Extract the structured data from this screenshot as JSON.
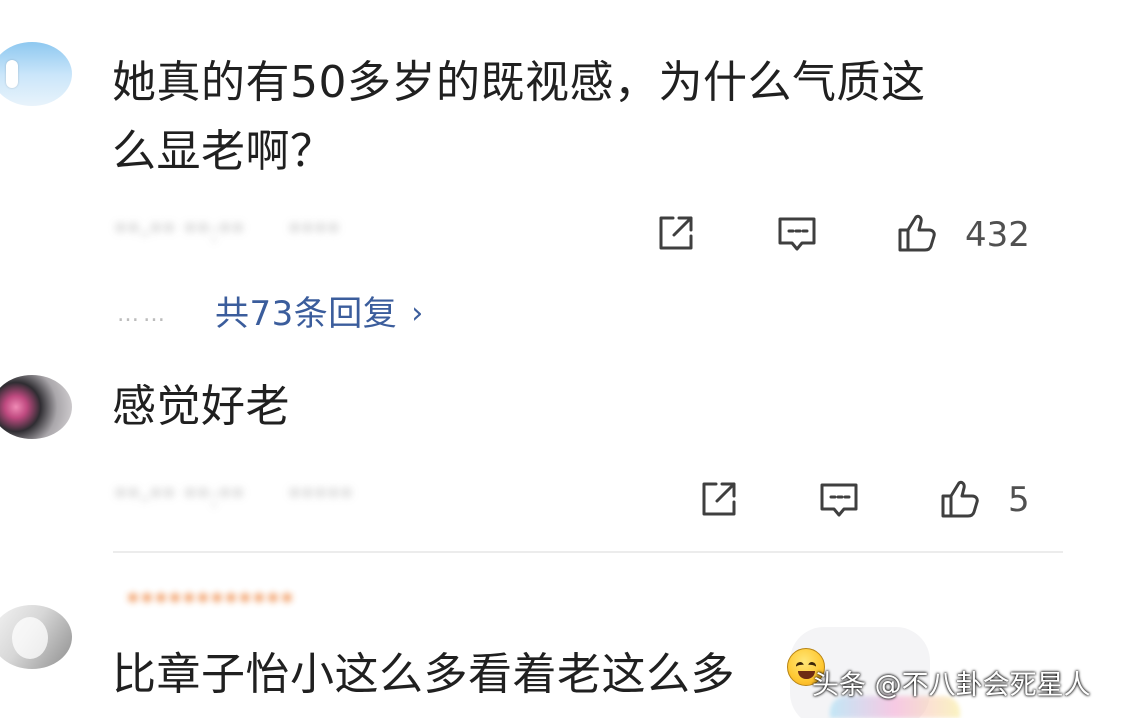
{
  "comments": [
    {
      "text_lines": [
        "她真的有50多岁的既视感，为什么气质这",
        "么显老啊？"
      ],
      "blurred_meta": "**-** **:**",
      "blurred_place": "****",
      "like_count": "432",
      "replies_text": "共73条回复"
    },
    {
      "text": "感觉好老",
      "blurred_meta": "**-** **:**",
      "blurred_place": "*****",
      "like_count": "5"
    },
    {
      "blurred_header": "************",
      "text": "比章子怡小这么多看着老这么多"
    }
  ],
  "watermark": "头条 @不八卦会死星人",
  "icons": {
    "share": "share-icon",
    "reply": "comment-icon",
    "like": "thumbs-up-icon",
    "chevron": "chevron-right-icon"
  },
  "colors": {
    "text": "#202020",
    "icon": "#3f3f3f",
    "link": "#3b5d9c",
    "muted": "#b8b8b8"
  }
}
